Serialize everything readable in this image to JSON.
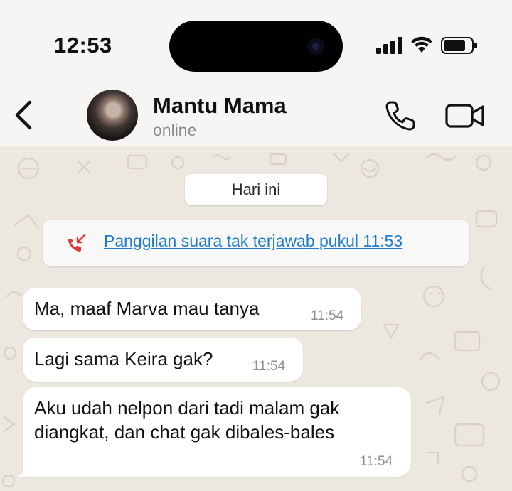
{
  "status_bar": {
    "time": "12:53",
    "icons": [
      "cellular-signal-icon",
      "wifi-icon",
      "battery-icon"
    ]
  },
  "header": {
    "contact_name": "Mantu Mama",
    "contact_status": "online",
    "icons": [
      "chevron-left-icon",
      "phone-icon",
      "video-camera-icon"
    ]
  },
  "chat": {
    "date_label": "Hari ini",
    "missed_call": {
      "text": "Panggilan suara tak terjawab pukul 11:53",
      "icon": "missed-call-icon",
      "color": "#e53935"
    },
    "messages": [
      {
        "text": "Ma, maaf Marva mau tanya",
        "time": "11:54"
      },
      {
        "text": "Lagi sama Keira gak?",
        "time": "11:54"
      },
      {
        "lines": [
          "Aku udah nelpon dari tadi malam gak",
          "diangkat, dan chat gak dibales-bales"
        ],
        "time": "11:54"
      }
    ]
  },
  "colors": {
    "chat_background": "#ece7df",
    "header_background": "#f6f5f3",
    "link": "#1f7dd1",
    "bubble": "#ffffff"
  }
}
